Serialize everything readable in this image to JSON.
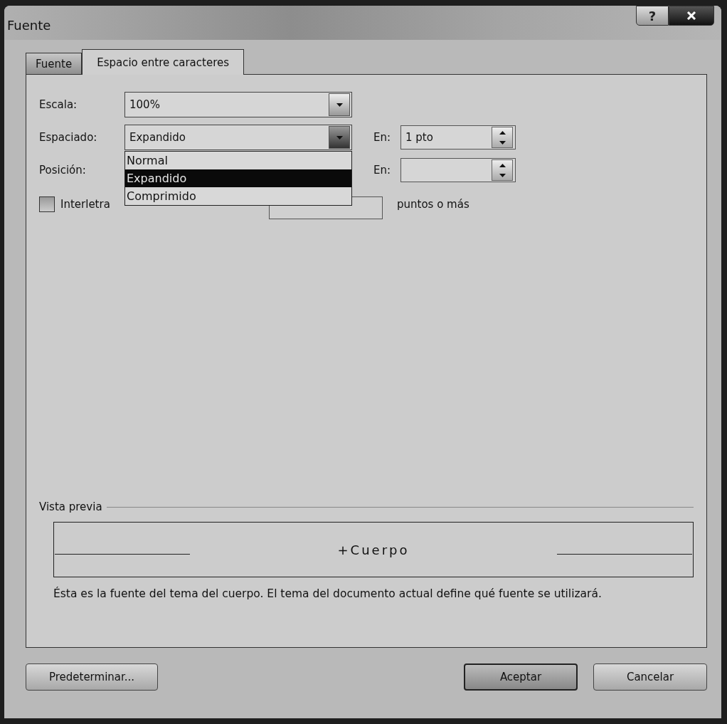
{
  "window": {
    "title": "Fuente",
    "help": "?"
  },
  "tabs": [
    {
      "label": "Fuente",
      "selected": false
    },
    {
      "label": "Espacio entre caracteres",
      "selected": true
    }
  ],
  "scale": {
    "label": "Escala:",
    "value": "100%"
  },
  "spacing": {
    "label": "Espaciado:",
    "value": "Expandido",
    "by_label": "En:",
    "by_value": "1 pto"
  },
  "position": {
    "label": "Posición:",
    "by_label": "En:"
  },
  "kerning": {
    "label": "Interletra",
    "checked": false,
    "suffix": "puntos o más"
  },
  "dropdown_list": [
    {
      "label": "Normal",
      "selected": false
    },
    {
      "label": "Expandido",
      "selected": true
    },
    {
      "label": "Comprimido",
      "selected": false
    }
  ],
  "preview": {
    "title": "Vista previa",
    "sample": "+Cuerpo",
    "description": "Ésta es la fuente del tema del cuerpo. El tema del documento actual define qué fuente se utilizará."
  },
  "buttons": [
    {
      "label": "Predeterminar...",
      "default": false
    },
    {
      "label": "Aceptar",
      "default": true
    },
    {
      "label": "Cancelar",
      "default": false
    }
  ]
}
